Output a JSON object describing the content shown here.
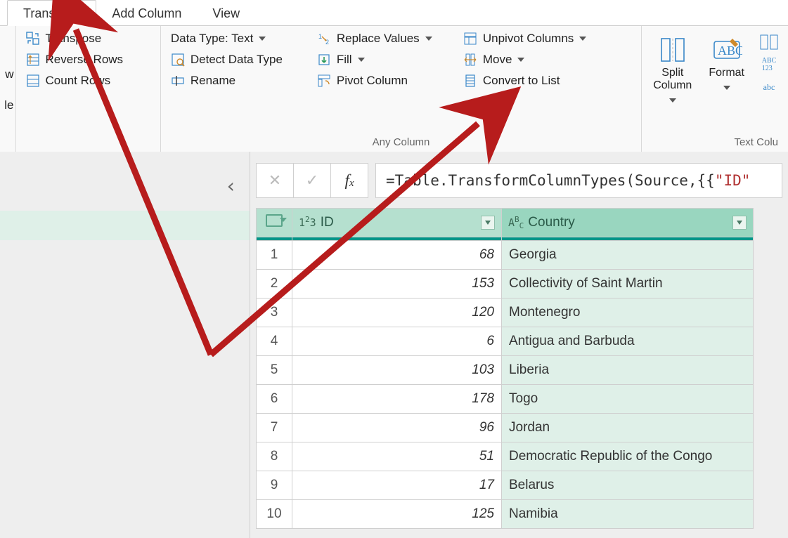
{
  "tabs": {
    "transform": "Transform",
    "add_column": "Add Column",
    "view": "View"
  },
  "left_slice": {
    "w": "w",
    "le": "le"
  },
  "table_group": {
    "transpose": "Transpose",
    "reverse_rows": "Reverse Rows",
    "count_rows": "Count Rows"
  },
  "any_column_group": {
    "label": "Any Column",
    "data_type": "Data Type: Text",
    "detect": "Detect Data Type",
    "rename": "Rename",
    "replace_values": "Replace Values",
    "fill": "Fill",
    "pivot": "Pivot Column",
    "unpivot": "Unpivot Columns",
    "move": "Move",
    "convert_list": "Convert to List"
  },
  "text_group": {
    "label": "Text Colu",
    "split": "Split\nColumn",
    "format": "Format"
  },
  "formula": {
    "prefix": "= ",
    "fn": "Table.TransformColumnTypes",
    "mid": "(Source,{{",
    "str": "\"ID\""
  },
  "grid": {
    "columns": {
      "id": "ID",
      "country": "Country"
    },
    "rows": [
      {
        "n": 1,
        "id": 68,
        "country": "Georgia"
      },
      {
        "n": 2,
        "id": 153,
        "country": "Collectivity of Saint Martin"
      },
      {
        "n": 3,
        "id": 120,
        "country": "Montenegro"
      },
      {
        "n": 4,
        "id": 6,
        "country": "Antigua and Barbuda"
      },
      {
        "n": 5,
        "id": 103,
        "country": "Liberia"
      },
      {
        "n": 6,
        "id": 178,
        "country": "Togo"
      },
      {
        "n": 7,
        "id": 96,
        "country": "Jordan"
      },
      {
        "n": 8,
        "id": 51,
        "country": "Democratic Republic of the Congo"
      },
      {
        "n": 9,
        "id": 17,
        "country": "Belarus"
      },
      {
        "n": 10,
        "id": 125,
        "country": "Namibia"
      }
    ]
  },
  "colors": {
    "arrow": "#b71c1c",
    "teal": "#009688"
  }
}
